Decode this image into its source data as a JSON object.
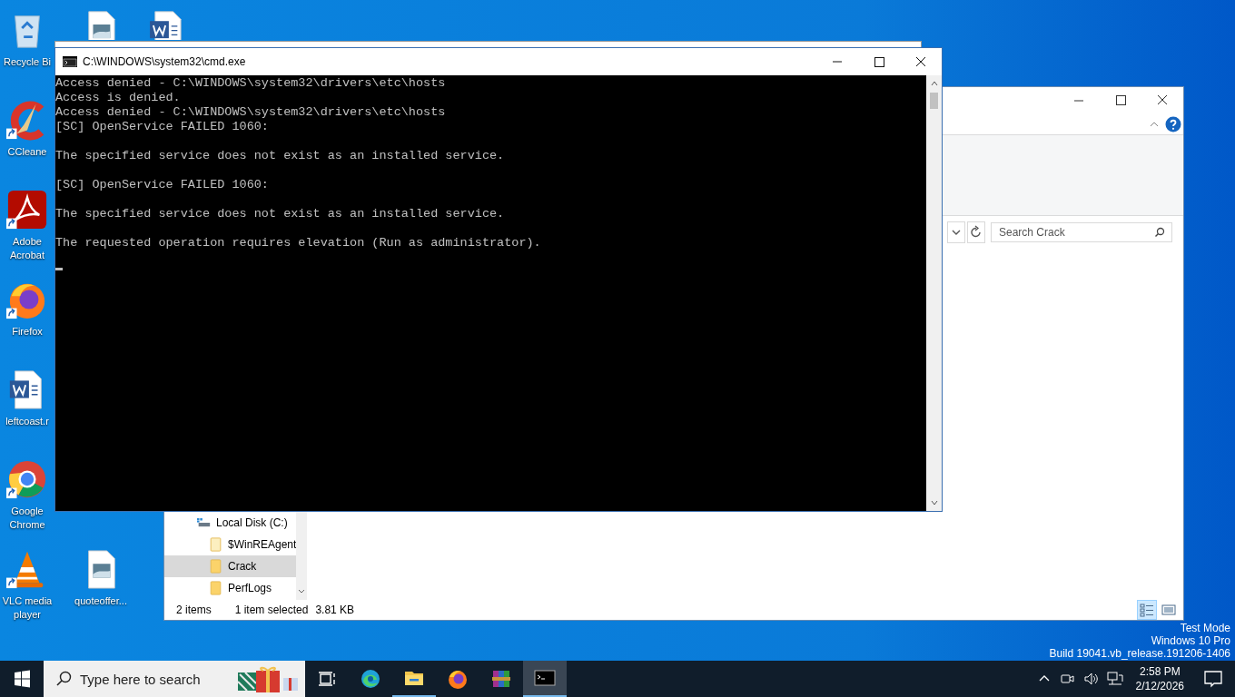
{
  "desktop_icons": [
    {
      "kind": "recycle",
      "label": "Recycle Bi",
      "shortcut": false
    },
    {
      "kind": "ccleaner",
      "label": "CCleane",
      "shortcut": true
    },
    {
      "kind": "acrobat",
      "label": "Adobe Acrobat",
      "shortcut": true
    },
    {
      "kind": "firefox",
      "label": "Firefox",
      "shortcut": true
    },
    {
      "kind": "word",
      "label": "leftcoast.r",
      "shortcut": false
    },
    {
      "kind": "chrome",
      "label": "Google Chrome",
      "shortcut": true
    },
    {
      "kind": "vlc",
      "label": "VLC media player",
      "shortcut": true
    },
    {
      "kind": "image",
      "shortcut": false
    },
    {
      "kind": "image",
      "label": "quoteoffer...",
      "shortcut": false
    },
    {
      "kind": "word",
      "shortcut": false
    }
  ],
  "explorer": {
    "search": {
      "placeholder": "Search Crack"
    },
    "tree": [
      {
        "label": "Local Disk (C:)",
        "kind": "drive",
        "selected": false,
        "children": [
          {
            "label": "$WinREAgent",
            "kind": "folder",
            "selected": false
          },
          {
            "label": "Crack",
            "kind": "folder",
            "selected": true
          },
          {
            "label": "PerfLogs",
            "kind": "folder",
            "selected": false
          }
        ]
      }
    ],
    "status": {
      "items": "2 items",
      "selection": "1 item selected",
      "size": "3.81 KB"
    },
    "views": [
      {
        "kind": "details",
        "selected": true
      },
      {
        "kind": "tiles",
        "selected": false
      }
    ]
  },
  "cmd_window": {
    "title": "C:\\WINDOWS\\system32\\cmd.exe",
    "lines": [
      {
        "kind": "text",
        "text": "Access denied - C:\\WINDOWS\\system32\\drivers\\etc\\hosts"
      },
      {
        "kind": "text",
        "text": "Access is denied."
      },
      {
        "kind": "text",
        "text": "Access denied - C:\\WINDOWS\\system32\\drivers\\etc\\hosts"
      },
      {
        "kind": "text",
        "text": "[SC] OpenService FAILED 1060:"
      },
      {
        "kind": "blank"
      },
      {
        "kind": "text",
        "text": "The specified service does not exist as an installed service."
      },
      {
        "kind": "blank"
      },
      {
        "kind": "text",
        "text": "[SC] OpenService FAILED 1060:"
      },
      {
        "kind": "blank"
      },
      {
        "kind": "text",
        "text": "The specified service does not exist as an installed service."
      },
      {
        "kind": "blank"
      },
      {
        "kind": "text",
        "text": "The requested operation requires elevation (Run as administrator)."
      },
      {
        "kind": "blank"
      }
    ]
  },
  "system_notice": [
    "Test Mode",
    "Windows 10 Pro",
    "Build 19041.vb_release.191206-1406"
  ],
  "taskbar": {
    "search": {
      "placeholder": "Type here to search"
    },
    "apps": [
      {
        "kind": "taskview",
        "running": false,
        "active": false
      },
      {
        "kind": "edge",
        "running": false,
        "active": false
      },
      {
        "kind": "explorer",
        "running": true,
        "active": false
      },
      {
        "kind": "firefox",
        "running": false,
        "active": false
      },
      {
        "kind": "winrar",
        "running": false,
        "active": false
      },
      {
        "kind": "cmd",
        "running": true,
        "active": true
      }
    ],
    "time": "2:58 PM",
    "date": "2/12/2026"
  }
}
